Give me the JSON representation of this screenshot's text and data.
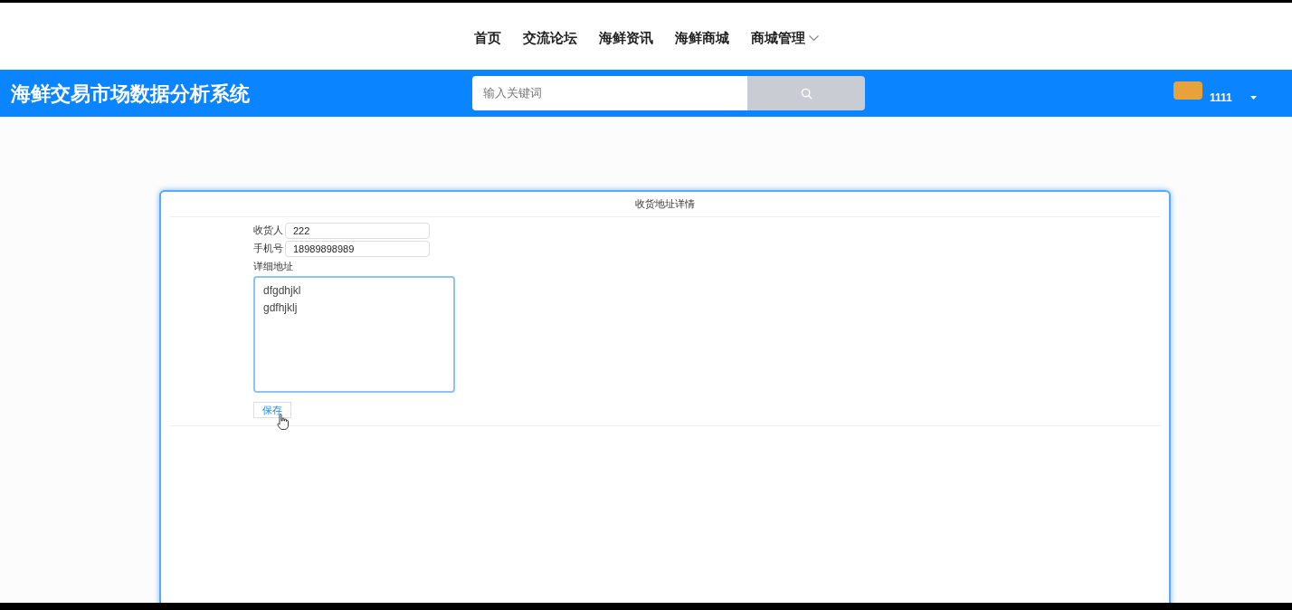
{
  "nav": [
    {
      "label": "首页",
      "dropdown": false
    },
    {
      "label": "交流论坛",
      "dropdown": false
    },
    {
      "label": "海鲜资讯",
      "dropdown": false
    },
    {
      "label": "海鲜商城",
      "dropdown": false
    },
    {
      "label": "商城管理",
      "dropdown": true
    }
  ],
  "header": {
    "title": "海鲜交易市场数据分析系统",
    "search": {
      "placeholder": "输入关键词"
    },
    "user": {
      "name": "1111"
    }
  },
  "card": {
    "title": "收货地址详情",
    "fields": [
      {
        "label": "收货人",
        "value": "222"
      },
      {
        "label": "手机号",
        "value": "18989898989"
      }
    ],
    "address": {
      "label": "详细地址",
      "value": "dfgdhjkl\ngdfhjklj"
    },
    "save_button": "保存"
  }
}
